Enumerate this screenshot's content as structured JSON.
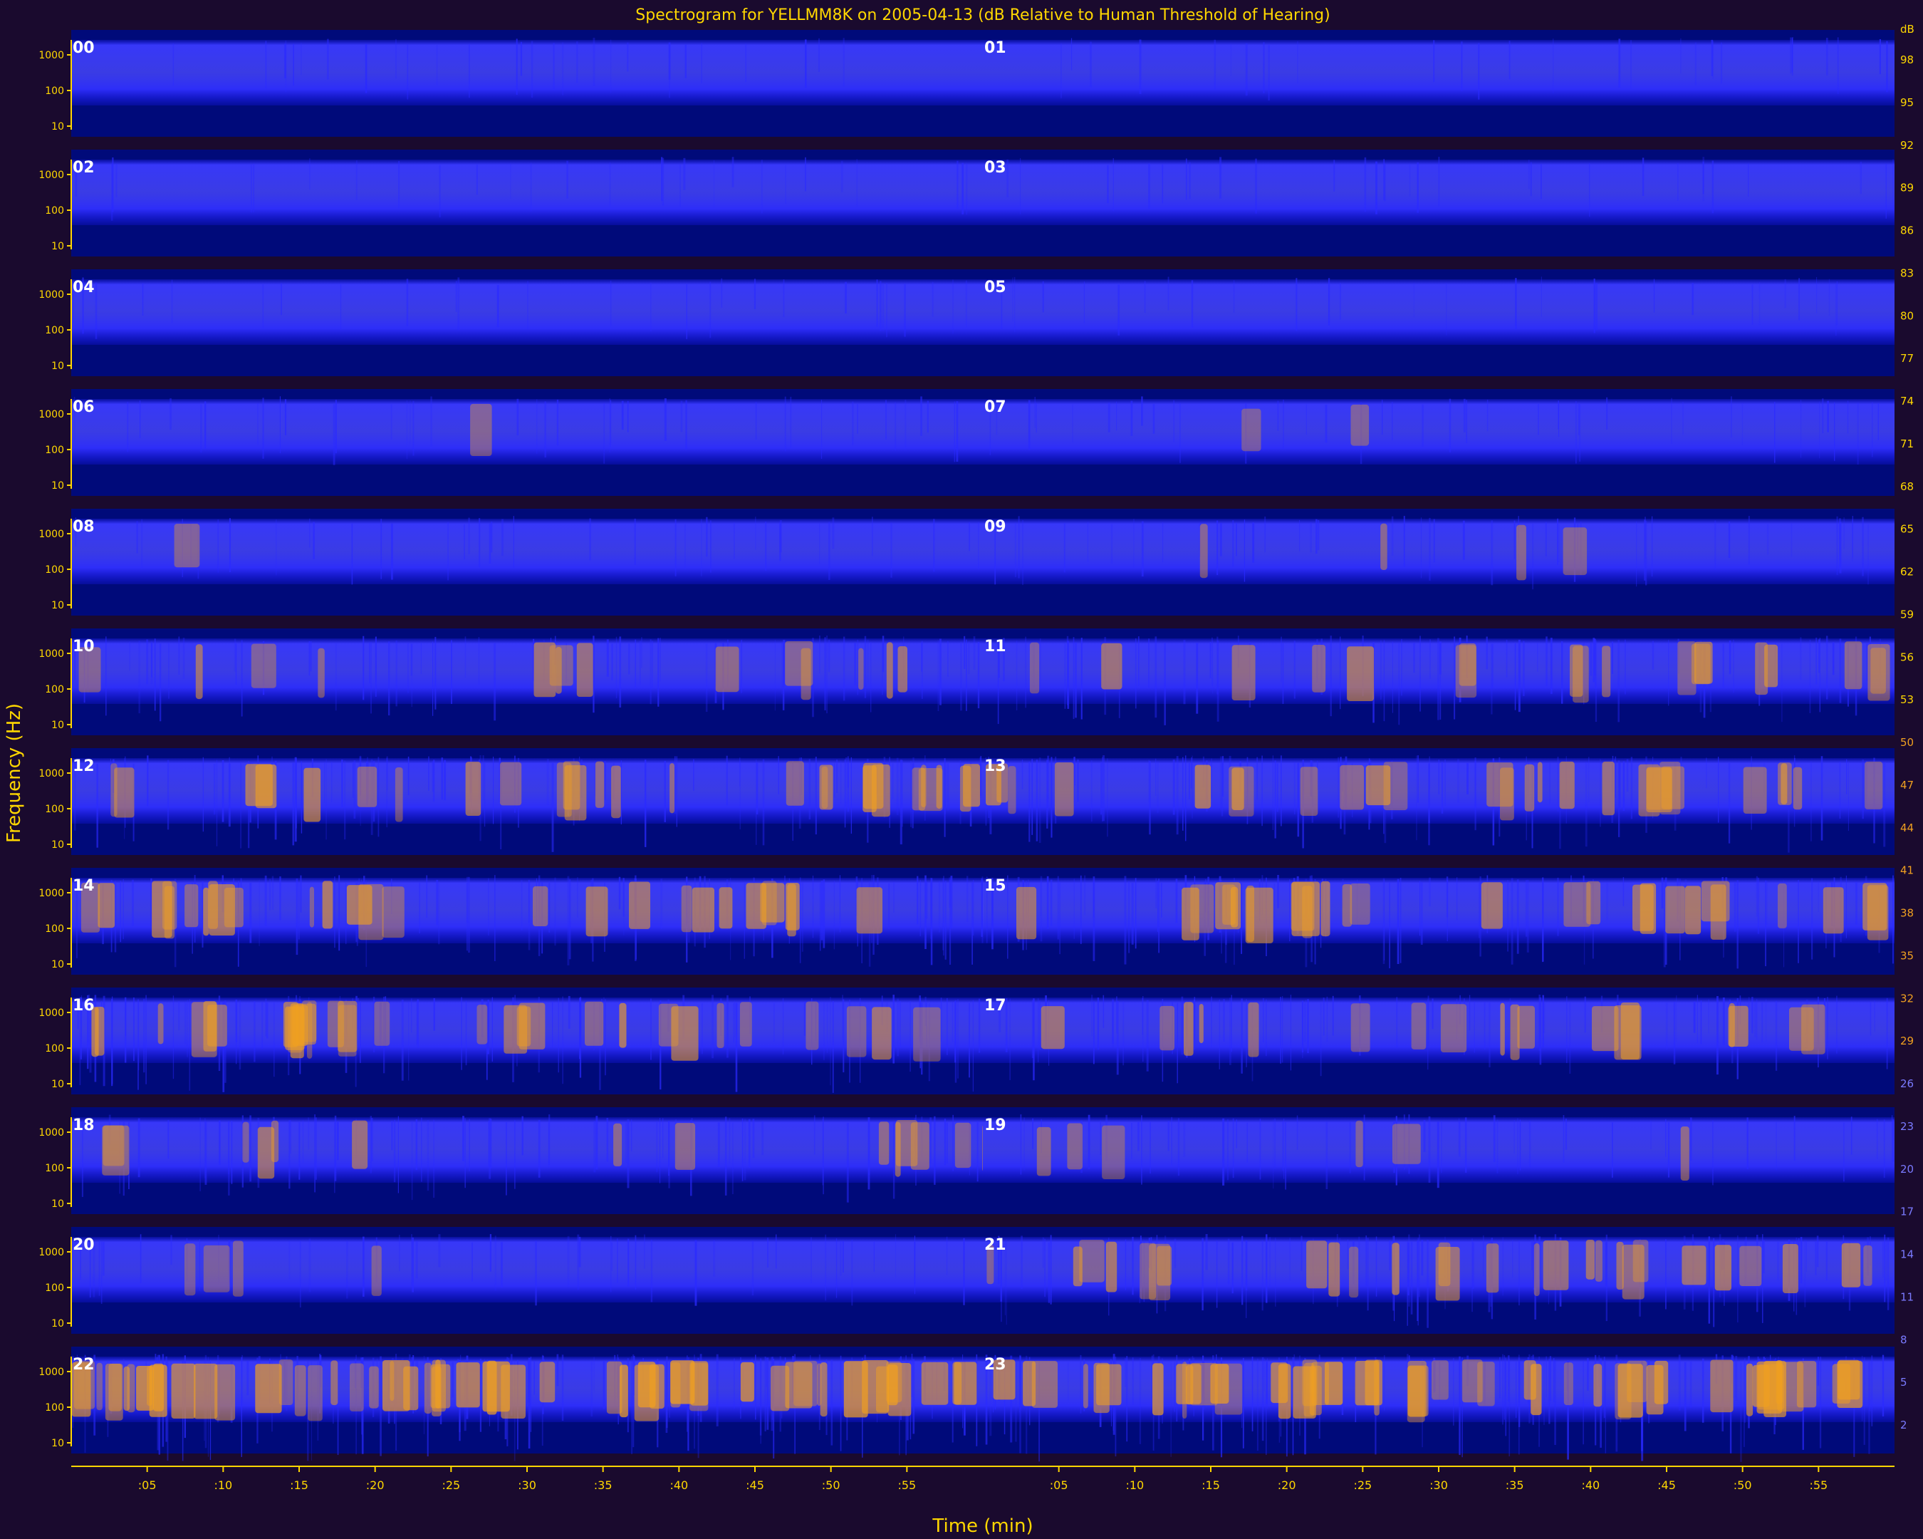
{
  "chart_data": {
    "type": "heatmap",
    "title": "Spectrogram for YELLMM8K on 2005-04-13 (dB Relative to Human Threshold of Hearing)",
    "xlabel": "Time (min)",
    "ylabel": "Frequency (Hz)",
    "colors": {
      "background": "#1a0a2e",
      "low": "#000a7a",
      "mid": "#2a2aff",
      "high": "#f0a020",
      "axis": "#ffd700",
      "hour_label": "#ffffff"
    },
    "freq_ticks": [
      "1000",
      "100",
      "10"
    ],
    "time_ticks": [
      ":05",
      ":10",
      ":15",
      ":20",
      ":25",
      ":30",
      ":35",
      ":40",
      ":45",
      ":50",
      ":55"
    ],
    "colorbar": {
      "unit": "dB",
      "ticks": [
        98,
        95,
        92,
        89,
        86,
        83,
        80,
        77,
        74,
        71,
        68,
        65,
        62,
        59,
        56,
        53,
        50,
        47,
        44,
        41,
        38,
        35,
        32,
        29,
        26,
        23,
        20,
        17,
        14,
        11,
        8,
        5,
        2
      ]
    },
    "hours": [
      {
        "label": "00",
        "intensity": 0.05
      },
      {
        "label": "01",
        "intensity": 0.05
      },
      {
        "label": "02",
        "intensity": 0.05
      },
      {
        "label": "03",
        "intensity": 0.06
      },
      {
        "label": "04",
        "intensity": 0.05
      },
      {
        "label": "05",
        "intensity": 0.05
      },
      {
        "label": "06",
        "intensity": 0.12
      },
      {
        "label": "07",
        "intensity": 0.15
      },
      {
        "label": "08",
        "intensity": 0.12
      },
      {
        "label": "09",
        "intensity": 0.2
      },
      {
        "label": "10",
        "intensity": 0.4
      },
      {
        "label": "11",
        "intensity": 0.45
      },
      {
        "label": "12",
        "intensity": 0.55
      },
      {
        "label": "13",
        "intensity": 0.55
      },
      {
        "label": "14",
        "intensity": 0.55
      },
      {
        "label": "15",
        "intensity": 0.55
      },
      {
        "label": "16",
        "intensity": 0.6
      },
      {
        "label": "17",
        "intensity": 0.45
      },
      {
        "label": "18",
        "intensity": 0.4
      },
      {
        "label": "19",
        "intensity": 0.25
      },
      {
        "label": "20",
        "intensity": 0.2
      },
      {
        "label": "21",
        "intensity": 0.55
      },
      {
        "label": "22",
        "intensity": 0.8
      },
      {
        "label": "23",
        "intensity": 0.75
      }
    ]
  }
}
